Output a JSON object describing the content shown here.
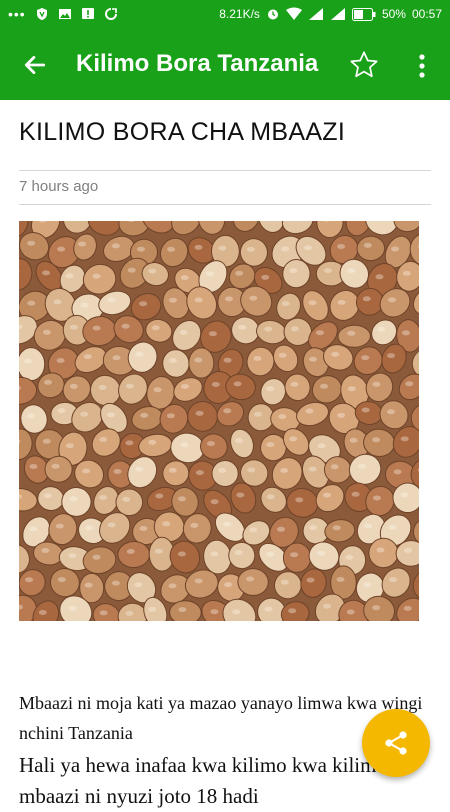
{
  "status_bar": {
    "network_speed": "8.21K/s",
    "battery": "50%",
    "time": "00:57",
    "icons": [
      "more-dots-icon",
      "vpn-shield-icon",
      "image-icon",
      "alert-icon",
      "sync-icon",
      "alarm-icon",
      "wifi-icon",
      "signal-icon",
      "battery-icon"
    ]
  },
  "app_bar": {
    "title": "Kilimo Bora Tanzania",
    "back_icon": "arrow-back-icon",
    "favorite_icon": "star-outline-icon",
    "menu_icon": "more-vert-icon"
  },
  "article": {
    "title": "KILIMO BORA CHA MBAAZI",
    "time_ago": "7 hours ago",
    "image_subject": "pigeon peas",
    "paragraph1": "Mbaazi ni moja kati ya mazao yanayo limwa kwa wingi nchini Tanzania",
    "paragraph2": "Hali ya hewa  inafaa kwa kilimo kwa kilimo mbaazi ni nyuzi joto 18 hadi"
  },
  "share_button": {
    "icon": "share-icon",
    "color": "#f5b800"
  },
  "colors": {
    "primary": "#1aa11a",
    "accent": "#f5b800"
  }
}
